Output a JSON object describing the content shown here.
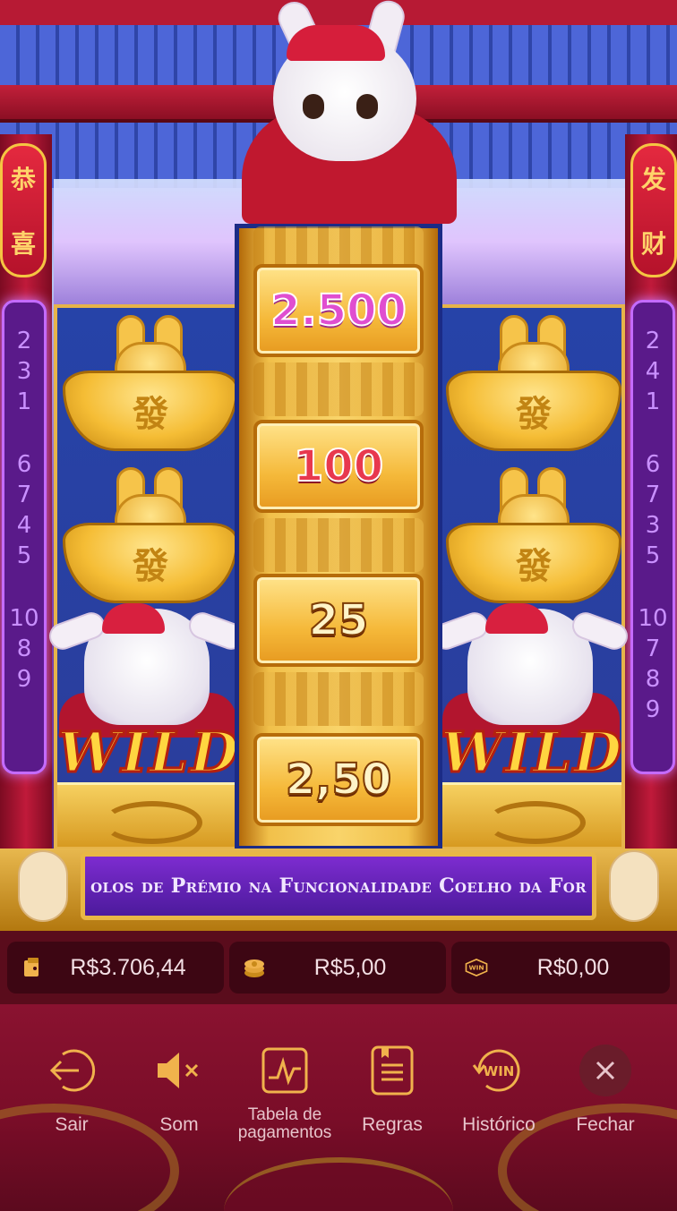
{
  "reels": {
    "left_lantern": [
      "恭",
      "喜"
    ],
    "right_lantern": [
      "发",
      "财"
    ],
    "left_neon": [
      [
        "2",
        "3",
        "1"
      ],
      [
        "6",
        "7",
        "4",
        "5"
      ],
      [
        "10",
        "8",
        "9"
      ]
    ],
    "right_neon": [
      [
        "2",
        "4",
        "1"
      ],
      [
        "6",
        "7",
        "3",
        "5"
      ],
      [
        "10",
        "7",
        "8",
        "9"
      ]
    ],
    "ingot_glyph": "發",
    "wild_text": "WILD",
    "center_values": [
      "2.500",
      "100",
      "25",
      "2,50"
    ],
    "center_colors": [
      "#e04ed0",
      "#e8384e",
      "#fff4c8",
      "#fff4c8"
    ]
  },
  "banner": {
    "text": "olos de Prémio na Funcionalidade Coelho da For"
  },
  "hud": {
    "balance": "R$3.706,44",
    "bet": "R$5,00",
    "win": "R$0,00",
    "win_icon_text": "WIN"
  },
  "menu": {
    "items": [
      {
        "label": "Sair",
        "icon": "exit-icon"
      },
      {
        "label": "Som",
        "icon": "sound-muted-icon"
      },
      {
        "label": "Tabela de pagamentos",
        "icon": "paytable-icon"
      },
      {
        "label": "Regras",
        "icon": "rules-icon"
      },
      {
        "label": "Histórico",
        "icon": "history-icon"
      },
      {
        "label": "Fechar",
        "icon": "close-icon"
      }
    ],
    "history_icon_text": "WIN"
  },
  "colors": {
    "accent_gold": "#e9b745",
    "menu_bg": "#7a0d28",
    "icon_gold": "#f0b24c"
  }
}
